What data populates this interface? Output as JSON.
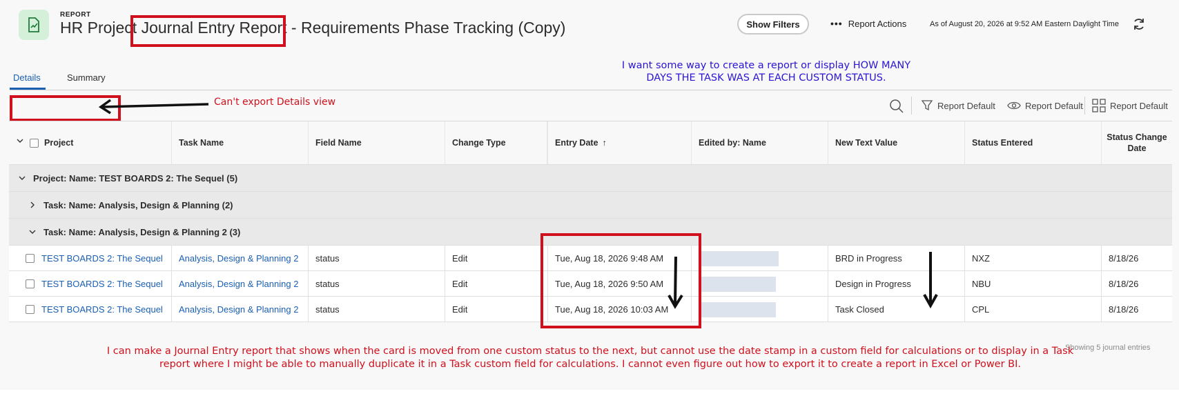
{
  "header": {
    "eyebrow": "REPORT",
    "title_part1": "HR Project ",
    "title_part2": "Journal Entry Report",
    "title_part3": " - Requirements Phase Tracking (Copy)",
    "show_filters": "Show Filters",
    "report_actions": "Report Actions",
    "as_of": "As of August 20, 2026 at 9:52 AM Eastern Daylight Time"
  },
  "tabs": [
    {
      "label": "Details",
      "active": true
    },
    {
      "label": "Summary",
      "active": false
    }
  ],
  "toolbar": {
    "filter_label": "Report Default",
    "view_label": "Report Default",
    "grouping_label": "Report Default"
  },
  "columns": [
    "Project",
    "Task Name",
    "Field Name",
    "Change Type",
    "Entry Date",
    "Edited by: Name",
    "New Text Value",
    "Status Entered",
    "Status Change Date"
  ],
  "sort_indicator": "↑",
  "groups": {
    "project": "Project: Name: TEST BOARDS 2: The Sequel (5)",
    "task1": "Task: Name: Analysis, Design & Planning (2)",
    "task2": "Task: Name: Analysis, Design & Planning 2 (3)"
  },
  "rows": [
    {
      "project": "TEST BOARDS 2: The Sequel",
      "task": "Analysis, Design & Planning 2",
      "field": "status",
      "change": "Edit",
      "entry_date": "Tue, Aug 18, 2026 9:48 AM",
      "new_value": "BRD in Progress",
      "status": "NXZ",
      "status_date": "8/18/26"
    },
    {
      "project": "TEST BOARDS 2: The Sequel",
      "task": "Analysis, Design & Planning 2",
      "field": "status",
      "change": "Edit",
      "entry_date": "Tue, Aug 18, 2026 9:50 AM",
      "new_value": "Design in Progress",
      "status": "NBU",
      "status_date": "8/18/26"
    },
    {
      "project": "TEST BOARDS 2: The Sequel",
      "task": "Analysis, Design & Planning 2",
      "field": "status",
      "change": "Edit",
      "entry_date": "Tue, Aug 18, 2026 10:03 AM",
      "new_value": "Task Closed",
      "status": "CPL",
      "status_date": "8/18/26"
    }
  ],
  "footer": {
    "showing": "Showing 5 journal entries"
  },
  "annotations": {
    "top_right": "I want some way to create a report or display HOW MANY DAYS THE TASK WAS AT EACH CUSTOM STATUS.",
    "export": "Can't export Details view",
    "bottom": "I can make a Journal Entry report that shows when the card is moved from one custom status to the next, but cannot use the date stamp in a custom field for calculations or to display in a Task report where I might be able to manually duplicate it in a Task custom field for calculations. I cannot even figure out how to export it to create a report in Excel or Power BI."
  },
  "colors": {
    "accent": "#1a5fb4",
    "annotation_red": "#d0101c",
    "annotation_blue": "#2a14d6"
  }
}
